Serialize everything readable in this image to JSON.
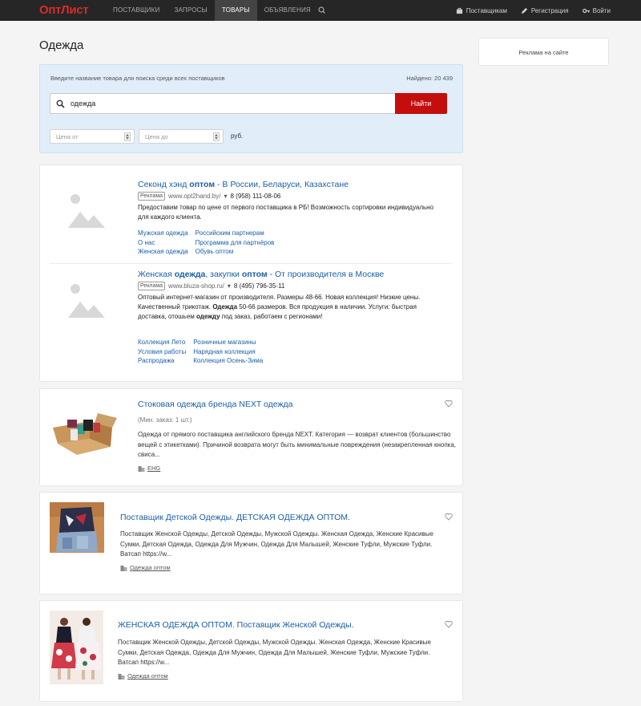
{
  "nav": {
    "logo": "ОптЛист",
    "items": [
      {
        "label": "ПОСТАВЩИКИ"
      },
      {
        "label": "ЗАПРОСЫ"
      },
      {
        "label": "ТОВАРЫ"
      },
      {
        "label": "ОБЪЯВЛЕНИЯ"
      }
    ],
    "right": {
      "suppliers": "Поставщикам",
      "register": "Регистрация",
      "login": "Войти"
    }
  },
  "page_title": "Одежда",
  "side_ad": "Реклама на сайте",
  "search": {
    "hint": "Введите название товара для поиска среди всех поставщиков",
    "found": "Найдено: 20 439",
    "query": "одежда",
    "button": "Найти",
    "price_from": "Цена от",
    "price_to": "Цена до",
    "currency": "руб."
  },
  "ads": [
    {
      "title_parts": [
        "Секонд хэнд ",
        "оптом",
        " - В России, Беларуси, Казахстане"
      ],
      "tag": "Реклама",
      "url": "www.opt2hand.by/",
      "phone": "8 (958) 111-08-06",
      "desc": "Предоставим товар по цене от первого поставщика в РБ! Возможность сортировки индивидуально для каждого клиента.",
      "links": [
        "Мужская одежда",
        "Российским партнерам",
        "О нас",
        "Программа для партнёров",
        "Женская одежда",
        "Обувь оптом"
      ]
    },
    {
      "title_parts": [
        "Женская ",
        "одежда",
        ", закупки ",
        "оптом",
        " - От производителя в Москве"
      ],
      "tag": "Реклама",
      "url": "www.bluza-shop.ru/",
      "phone": "8 (495) 796-35-11",
      "desc_parts": [
        "Оптовый интернет-магазин от производителя. Размеры 48-66. Новая коллекция! Низкие цены. Качественный трикотаж. ",
        "Одежда",
        " 50-66 размеров. Вся продукция в наличии. Услуги: быстрая доставка, отошьем ",
        "одежду",
        " под заказ, работаем с регионами!"
      ],
      "links": [
        "Коллекция Лето",
        "Розничные магазины",
        "Условия работы",
        "Нарядная коллекция",
        "Распродажа",
        "Коллекция Осень-Зима"
      ]
    }
  ],
  "products": [
    {
      "title": "Стоковая одежда бренда NEXT одежда",
      "min_order": "(Мин. заказ: 1 шт.)",
      "desc": "Одежда от прямого поставщика английского бренда NEXT. Категория — возврат клиентов (большинство вещей с этикетками). Причиной возврата могут быть минимальные повреждения (незакрепленная кнопка, свиса...",
      "supplier": "EHG"
    },
    {
      "title": "Поставщик Детской Одежды. ДЕТСКАЯ ОДЕЖДА ОПТОМ.",
      "desc": "Поставщик Женской Одежды, Детской Одежды, Мужской Одежды. Женская Одежда, Женские Красивые Сумки, Детская Одежда, Одежда Для Мужчин, Одежда Для Малышей, Женские Туфли, Мужские Туфли. Ватсап https://w...",
      "supplier": "Одежда оптом"
    },
    {
      "title": "ЖЕНСКАЯ ОДЕЖДА ОПТОМ. Поставщик Женской Одежды.",
      "desc": "Поставщик Женской Одежды, Детской Одежды, Мужской Одежды. Женская Одежда, Женские Красивые Сумки, Детская Одежда, Одежда Для Мужчин, Одежда Для Малышей, Женские Туфли, Мужские Туфли. Ватсап https://w...",
      "supplier": "Одежда оптом"
    }
  ],
  "colors": {
    "brand": "#d72c2c",
    "button": "#c40d0d",
    "link": "#1a5fa8",
    "nav_bg": "#262626"
  }
}
